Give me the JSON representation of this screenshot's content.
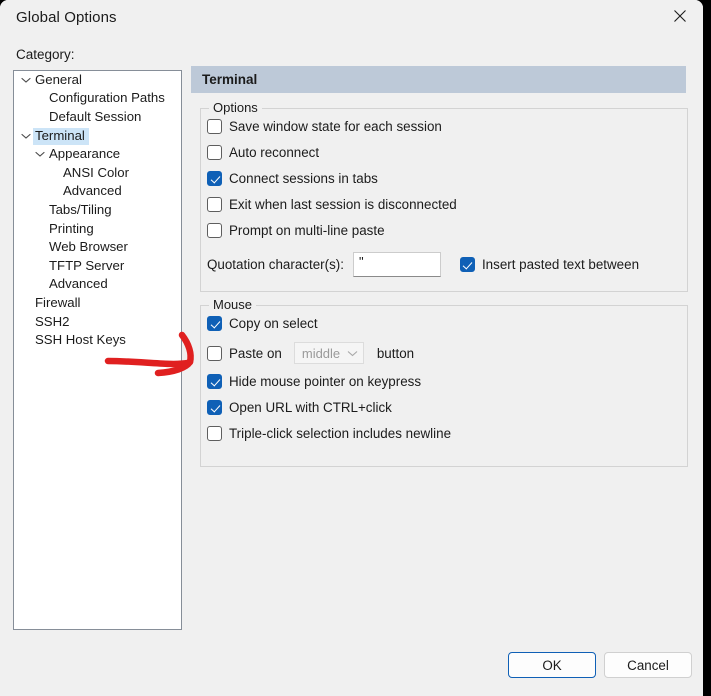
{
  "window": {
    "title": "Global Options",
    "close_icon": "close-icon"
  },
  "category": {
    "label": "Category:",
    "tree": [
      {
        "label": "General",
        "indent": 0,
        "chevron": "chevron-down-icon",
        "selected": false
      },
      {
        "label": "Configuration Paths",
        "indent": 1,
        "chevron": null,
        "selected": false
      },
      {
        "label": "Default Session",
        "indent": 1,
        "chevron": null,
        "selected": false
      },
      {
        "label": "Terminal",
        "indent": 0,
        "chevron": "chevron-down-icon",
        "selected": true
      },
      {
        "label": "Appearance",
        "indent": 1,
        "chevron": "chevron-down-icon",
        "selected": false
      },
      {
        "label": "ANSI Color",
        "indent": 2,
        "chevron": null,
        "selected": false
      },
      {
        "label": "Advanced",
        "indent": 2,
        "chevron": null,
        "selected": false
      },
      {
        "label": "Tabs/Tiling",
        "indent": 1,
        "chevron": null,
        "selected": false
      },
      {
        "label": "Printing",
        "indent": 1,
        "chevron": null,
        "selected": false
      },
      {
        "label": "Web Browser",
        "indent": 1,
        "chevron": null,
        "selected": false
      },
      {
        "label": "TFTP Server",
        "indent": 1,
        "chevron": null,
        "selected": false
      },
      {
        "label": "Advanced",
        "indent": 1,
        "chevron": null,
        "selected": false
      },
      {
        "label": "Firewall",
        "indent": 0,
        "chevron": null,
        "selected": false
      },
      {
        "label": "SSH2",
        "indent": 0,
        "chevron": null,
        "selected": false
      },
      {
        "label": "SSH Host Keys",
        "indent": 0,
        "chevron": null,
        "selected": false
      }
    ]
  },
  "panel": {
    "header": "Terminal",
    "options_group": {
      "title": "Options",
      "checkboxes": [
        {
          "label": "Save window state for each session",
          "checked": false
        },
        {
          "label": "Auto reconnect",
          "checked": false
        },
        {
          "label": "Connect sessions in tabs",
          "checked": true
        },
        {
          "label": "Exit when last session is disconnected",
          "checked": false
        },
        {
          "label": "Prompt on multi-line paste",
          "checked": false
        }
      ],
      "quotation_label": "Quotation character(s):",
      "quotation_value": "\"",
      "quotation_placeholder": "",
      "insert_between_label": "Insert pasted text between",
      "insert_between_checked": true
    },
    "mouse_group": {
      "title": "Mouse",
      "copy_on_select": {
        "label": "Copy on select",
        "checked": true
      },
      "paste_on": {
        "label": "Paste on",
        "checked": false,
        "dropdown_value": "middle",
        "dropdown_enabled": false,
        "dropdown_icon": "chevron-down-icon",
        "suffix_label": "button"
      },
      "others": [
        {
          "label": "Hide mouse pointer on keypress",
          "checked": true
        },
        {
          "label": "Open URL with CTRL+click",
          "checked": true
        },
        {
          "label": "Triple-click selection includes newline",
          "checked": false
        }
      ]
    }
  },
  "footer": {
    "ok_label": "OK",
    "cancel_label": "Cancel"
  },
  "annotation": {
    "type": "red-arrow",
    "color": "#e02020",
    "points_to": "paste-on-checkbox"
  }
}
